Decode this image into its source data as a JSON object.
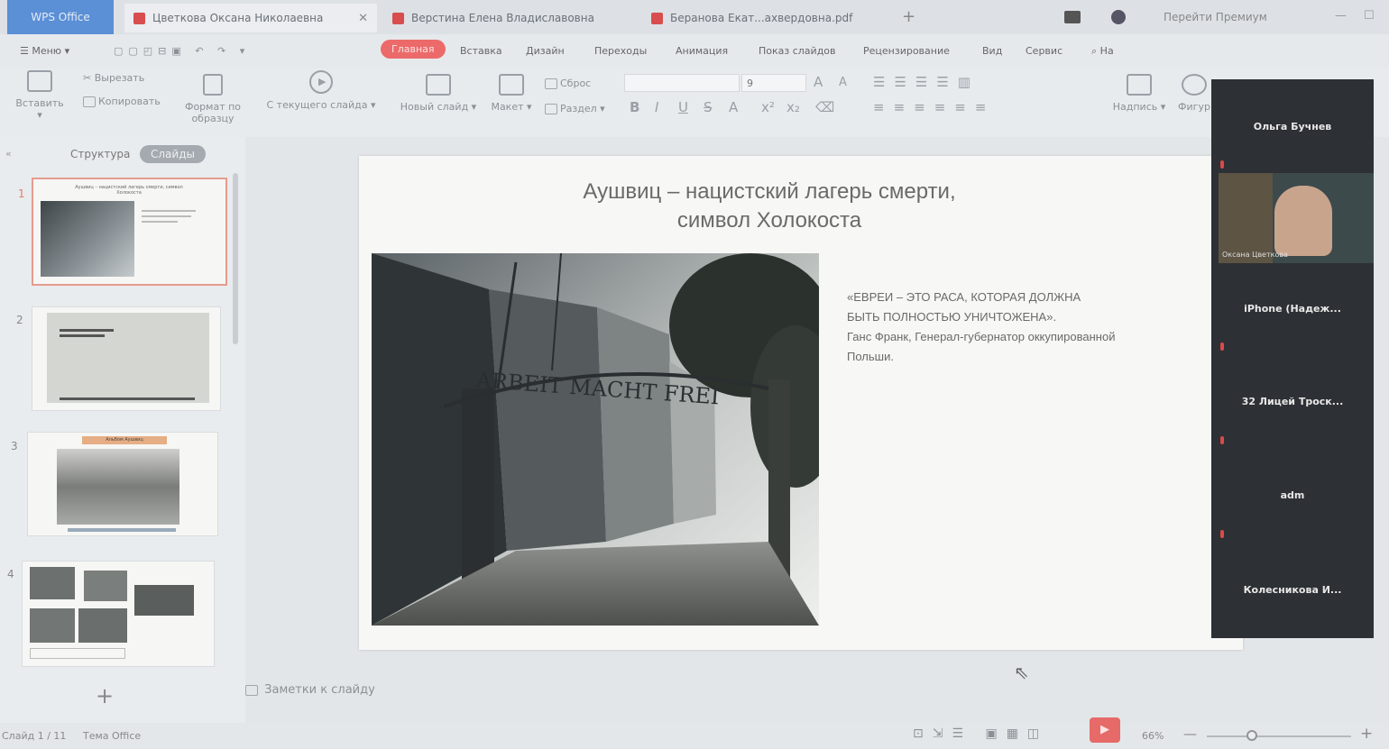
{
  "tabs": {
    "app": "WPS Office",
    "items": [
      {
        "label": "Цветкова Оксана Николаевна"
      },
      {
        "label": "Верстина Елена Владиславовна"
      },
      {
        "label": "Беранова Екат...ахвердовна.pdf"
      }
    ],
    "account": "Перейти Премиум"
  },
  "menu": {
    "menu_label": "Меню",
    "items": [
      "Главная",
      "Вставка",
      "Дизайн",
      "Переходы",
      "Анимация",
      "Показ слайдов",
      "Рецензирование",
      "Вид",
      "Сервис"
    ],
    "search_label": "На"
  },
  "ribbon": {
    "paste": "Вставить",
    "cut": "Вырезать",
    "copy": "Копировать",
    "format_painter": "Формат по образцу",
    "from_current": "С текущего слайда",
    "new_slide": "Новый слайд",
    "layout": "Макет",
    "reset": "Сброс",
    "section": "Раздел",
    "font_size": "9",
    "textbox": "Надпись",
    "shapes": "Фигур"
  },
  "panel": {
    "tab_structure": "Структура",
    "tab_slides": "Слайды",
    "thumb1_title": "Аушвиц – нацистский лагерь смерти, символ Холокоста",
    "thumb3_title": "Альбом Аушвиц",
    "numbers": [
      "1",
      "2",
      "3",
      "4"
    ]
  },
  "slide": {
    "title_line1": "Аушвиц – нацистский лагерь смерти,",
    "title_line2": "символ Холокоста",
    "photo_sign": "ARBEIT MACHT FREI",
    "quote_line1": "«ЕВРЕИ – ЭТО РАСА, КОТОРАЯ ДОЛЖНА",
    "quote_line2": "БЫТЬ ПОЛНОСТЬЮ УНИЧТОЖЕНА».",
    "quote_line3": "Ганс Франк, Генерал-губернатор оккупированной",
    "quote_line4": "Польши."
  },
  "notes_label": "Заметки к слайду",
  "participants": [
    "Ольга Бучнев",
    "Оксана Цветкова",
    "iPhone  (Надеж...",
    "32 Лицей Троск...",
    "adm",
    "Колесникова  И..."
  ],
  "status": {
    "slide_info": "Слайд 1 / 11",
    "theme": "Тема Office",
    "zoom": "66%"
  }
}
